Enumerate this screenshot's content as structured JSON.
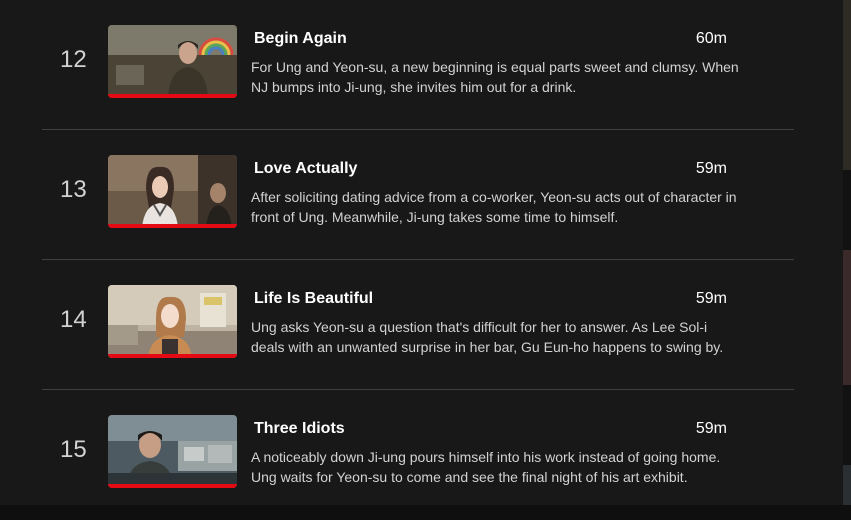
{
  "episodes": [
    {
      "number": "12",
      "title": "Begin Again",
      "duration": "60m",
      "description": "For Ung and Yeon-su, a new beginning is equal parts sweet and clumsy. When NJ bumps into Ji-ung, she invites him out for a drink.",
      "progress": 1.0
    },
    {
      "number": "13",
      "title": "Love Actually",
      "duration": "59m",
      "description": "After soliciting dating advice from a co-worker, Yeon-su acts out of character in front of Ung. Meanwhile, Ji-ung takes some time to himself.",
      "progress": 1.0
    },
    {
      "number": "14",
      "title": "Life Is Beautiful",
      "duration": "59m",
      "description": "Ung asks Yeon-su a question that's difficult for her to answer. As Lee Sol-i deals with an unwanted surprise in her bar, Gu Eun-ho happens to swing by.",
      "progress": 1.0
    },
    {
      "number": "15",
      "title": "Three Idiots",
      "duration": "59m",
      "description": "A noticeably down Ji-ung pours himself into his work instead of going home. Ung waits for Yeon-su to come and see the final night of his art exhibit.",
      "progress": 1.0
    }
  ],
  "colors": {
    "background": "#181818",
    "progress": "#e50914",
    "divider": "#404040"
  }
}
